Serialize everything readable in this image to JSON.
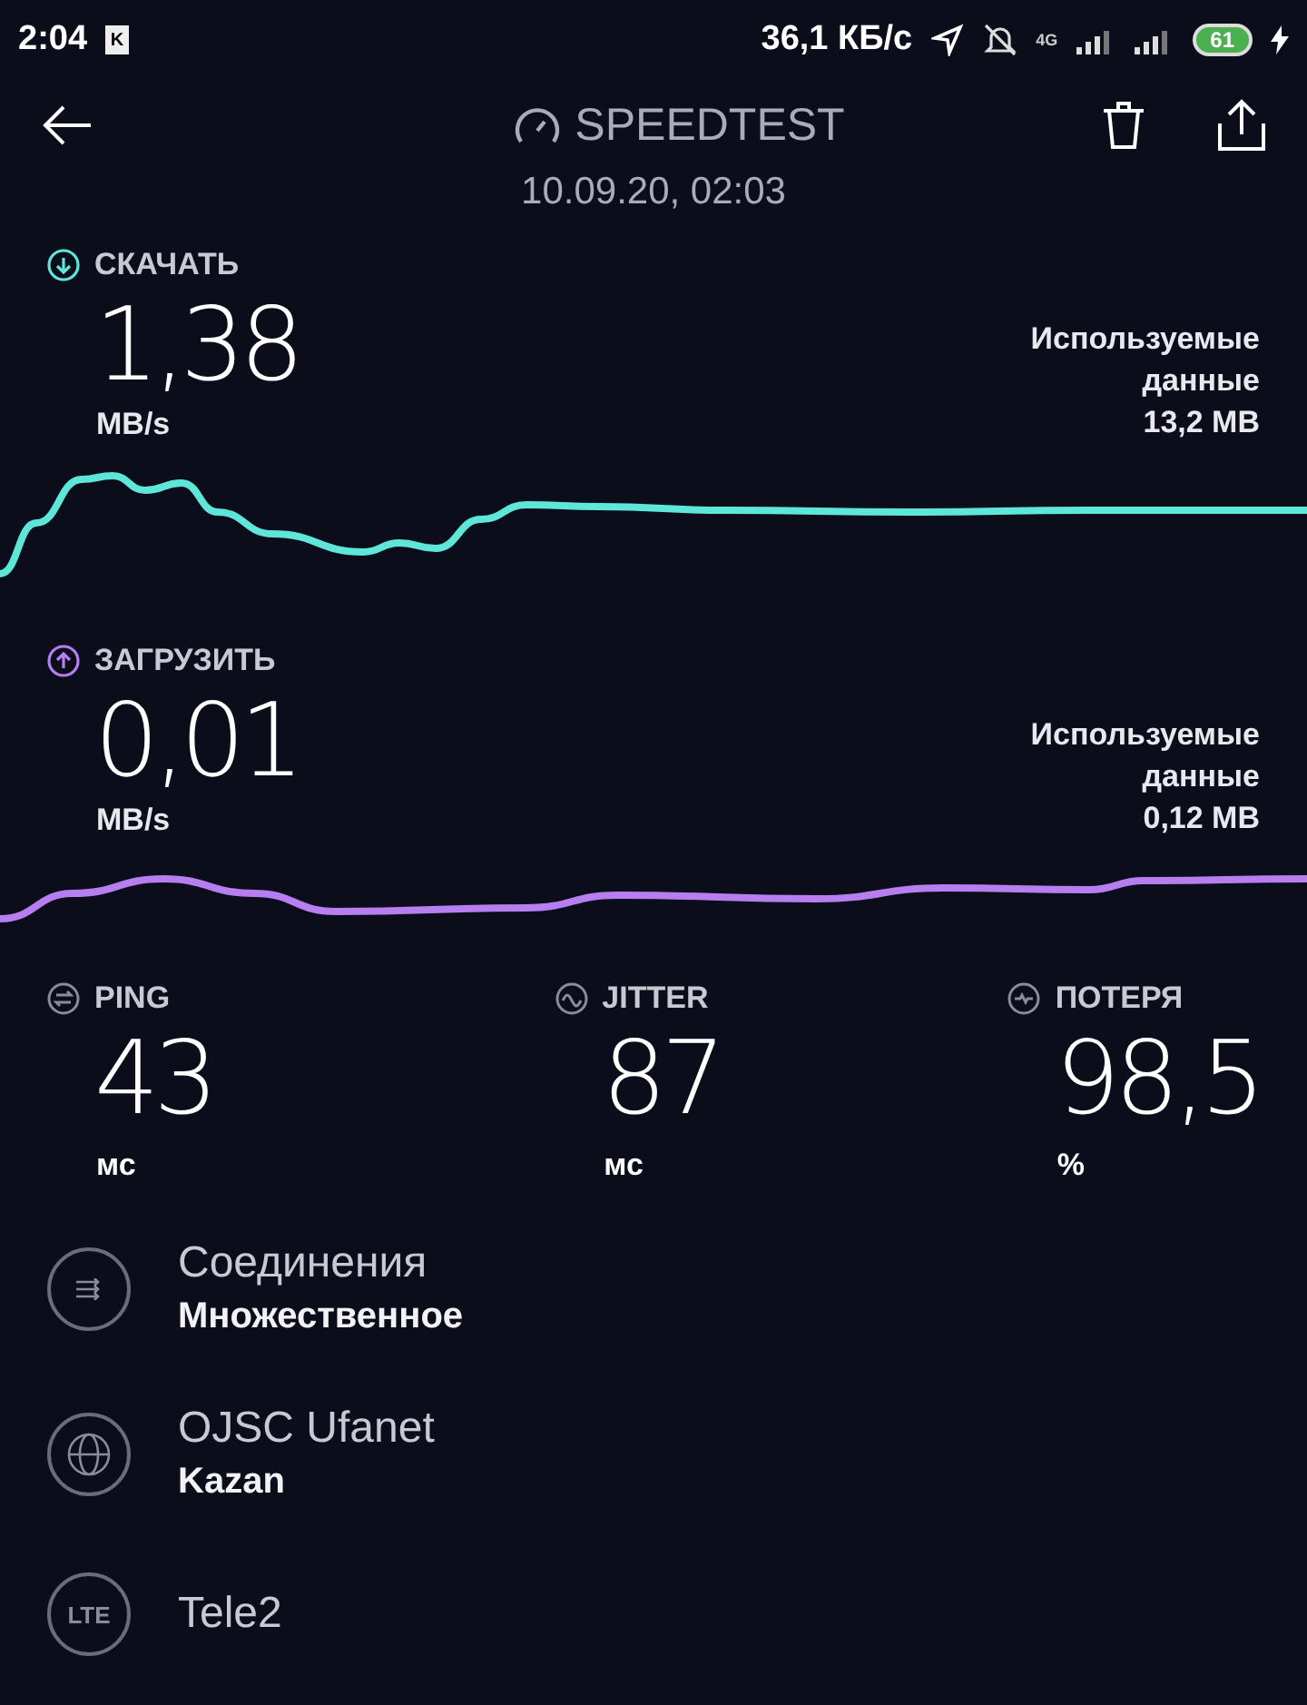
{
  "status_bar": {
    "time": "2:04",
    "notification_badge": "K",
    "speed": "36,1 КБ/с",
    "network": "4G",
    "battery": "61"
  },
  "header": {
    "title": "SPEEDTEST",
    "date": "10.09.20, 02:03"
  },
  "tests": [
    {
      "kind": "download",
      "label": "СКАЧАТЬ",
      "value": "1,38",
      "unit": "MB/s",
      "data_label": "Используемые данные",
      "data_value": "13,2 MB",
      "color": "#5ee6d9"
    },
    {
      "kind": "upload",
      "label": "ЗАГРУЗИТЬ",
      "value": "0,01",
      "unit": "MB/s",
      "data_label": "Используемые данные",
      "data_value": "0,12 MB",
      "color": "#b77ef0"
    }
  ],
  "metrics": [
    {
      "kind": "ping",
      "label": "PING",
      "value": "43",
      "unit": "мс"
    },
    {
      "kind": "jitter",
      "label": "JITTER",
      "value": "87",
      "unit": "мс"
    },
    {
      "kind": "loss",
      "label": "ПОТЕРЯ",
      "value": "98,5",
      "unit": "%"
    }
  ],
  "details": [
    {
      "kind": "connections",
      "title": "Соединения",
      "subtitle": "Множественное"
    },
    {
      "kind": "server",
      "title": "OJSC Ufanet",
      "subtitle": "Kazan"
    },
    {
      "kind": "carrier",
      "badge": "LTE",
      "title": "Tele2"
    }
  ]
}
